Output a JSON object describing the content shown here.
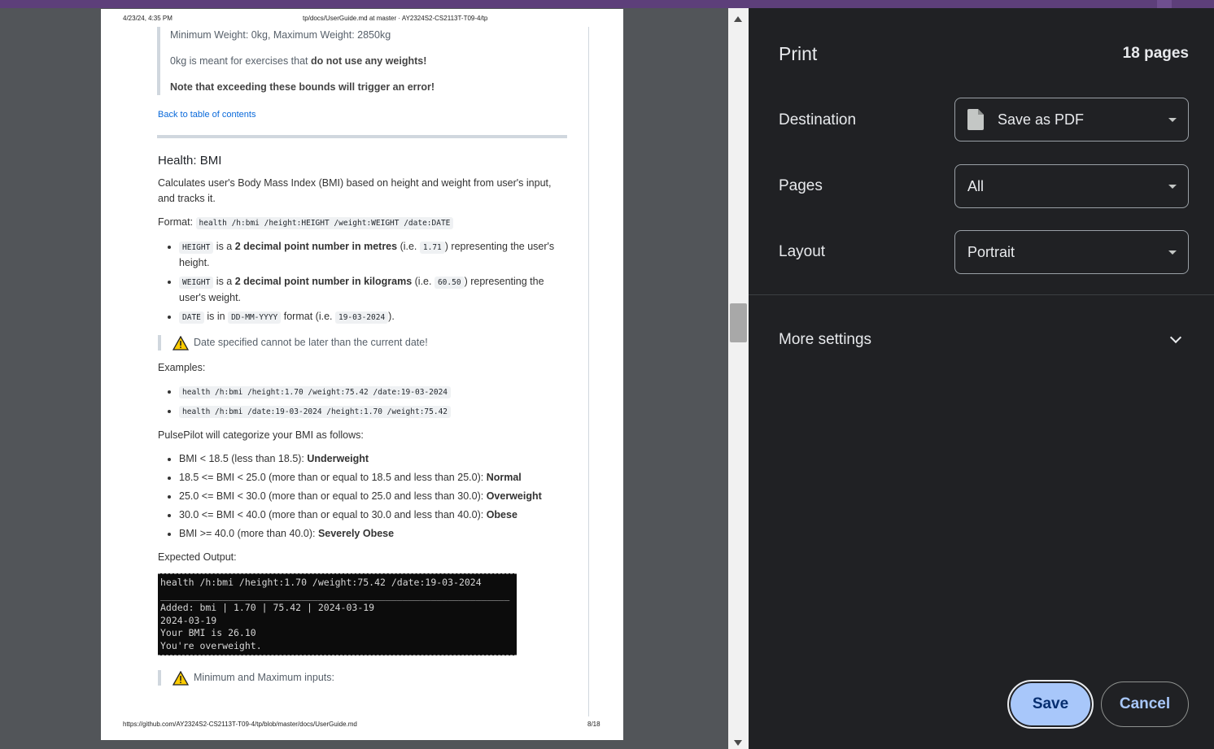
{
  "preview": {
    "header_left": "4/23/24, 4:35 PM",
    "header_center": "tp/docs/UserGuide.md at master · AY2324S2-CS2113T-T09-4/tp",
    "footer_left": "https://github.com/AY2324S2-CS2113T-T09-4/tp/blob/master/docs/UserGuide.md",
    "footer_right": "8/18",
    "quote_line1": "Minimum Weight: 0kg, Maximum Weight: 2850kg",
    "quote_line2_a": "0kg is meant for exercises that ",
    "quote_line2_b": "do not use any weights!",
    "quote_line3": "Note that exceeding these bounds will trigger an error!",
    "back_link": "Back to table of contents",
    "heading": "Health: BMI",
    "description": "Calculates user's Body Mass Index (BMI) based on height and weight from user's input, and tracks it.",
    "format_label": "Format: ",
    "format_code": "health /h:bmi /height:HEIGHT /weight:WEIGHT /date:DATE",
    "params": {
      "height_code": "HEIGHT",
      "height_a": " is a ",
      "height_b": "2 decimal point number in metres",
      "height_c": " (i.e. ",
      "height_ex": "1.71",
      "height_d": ") representing the user's height.",
      "weight_code": "WEIGHT",
      "weight_a": " is a ",
      "weight_b": "2 decimal point number in kilograms",
      "weight_c": " (i.e. ",
      "weight_ex": "60.50",
      "weight_d": ") representing the user's weight.",
      "date_code": "DATE",
      "date_a": " is in ",
      "date_fmt": "DD-MM-YYYY",
      "date_b": " format (i.e. ",
      "date_ex": "19-03-2024",
      "date_c": ")."
    },
    "note_date": "Date specified cannot be later than the current date!",
    "examples_label": "Examples:",
    "examples": [
      "health /h:bmi /height:1.70 /weight:75.42 /date:19-03-2024",
      "health /h:bmi /date:19-03-2024 /height:1.70 /weight:75.42"
    ],
    "categorize_label": "PulsePilot will categorize your BMI as follows:",
    "categories": [
      {
        "text": "BMI < 18.5 (less than 18.5): ",
        "bold": "Underweight"
      },
      {
        "text": "18.5 <= BMI < 25.0 (more than or equal to 18.5 and less than 25.0): ",
        "bold": "Normal"
      },
      {
        "text": "25.0 <= BMI < 30.0 (more than or equal to 25.0 and less than 30.0): ",
        "bold": "Overweight"
      },
      {
        "text": "30.0 <= BMI < 40.0 (more than or equal to 30.0 and less than 40.0): ",
        "bold": "Obese"
      },
      {
        "text": "BMI >= 40.0 (more than 40.0): ",
        "bold": "Severely Obese"
      }
    ],
    "expected_label": "Expected Output:",
    "terminal": "health /h:bmi /height:1.70 /weight:75.42 /date:19-03-2024\n______________________________________________________________\nAdded: bmi | 1.70 | 75.42 | 2024-03-19\n2024-03-19\nYour BMI is 26.10\nYou're overweight.",
    "note_minmax": "Minimum and Maximum inputs:"
  },
  "print_panel": {
    "title": "Print",
    "page_count": "18 pages",
    "destination_label": "Destination",
    "destination_value": "Save as PDF",
    "pages_label": "Pages",
    "pages_value": "All",
    "layout_label": "Layout",
    "layout_value": "Portrait",
    "more_settings": "More settings",
    "save_button": "Save",
    "cancel_button": "Cancel"
  },
  "colors": {
    "panel_bg": "#202124",
    "save_button_bg": "#a8c7fa",
    "link": "#0969da"
  }
}
